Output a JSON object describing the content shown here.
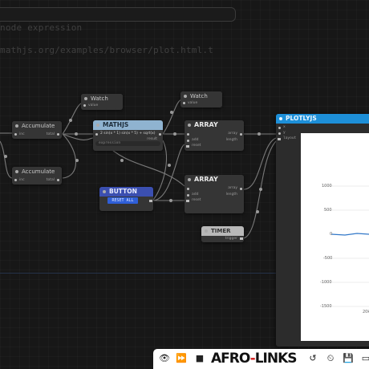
{
  "background_text": {
    "line1": "node expression",
    "line2": "mathjs.org/examples/browser/plot.html.t"
  },
  "nodes": {
    "watch1": {
      "title": "Watch",
      "port_in": "value"
    },
    "watch2": {
      "title": "Watch",
      "port_in": "value"
    },
    "accumulate1": {
      "title": "Accumulate",
      "port_in": "inc",
      "port_out": "total"
    },
    "accumulate2": {
      "title": "Accumulate",
      "port_in": "inc",
      "port_out": "total"
    },
    "mathjs": {
      "title": "MATHJS",
      "port_in": "x",
      "port_out": "result",
      "formula": "2 sin(x * 1) sin(x * 5) + sqrt(x)",
      "expression": "expression"
    },
    "array1": {
      "title": "ARRAY",
      "port_in1": "value",
      "port_in2": "add",
      "port_in3": "reset",
      "port_out1": "array",
      "port_out2": "length"
    },
    "array2": {
      "title": "ARRAY",
      "port_in1": "value",
      "port_in2": "add",
      "port_in3": "reset",
      "port_out1": "array",
      "port_out2": "length"
    },
    "button": {
      "title": "BUTTON",
      "reset_label": "RESET ALL"
    },
    "timer": {
      "title": "TIMER",
      "port_out": "trigger"
    },
    "plotlyjs": {
      "title": "PLOTLYJS",
      "port_in1": "x",
      "port_in2": "y",
      "port_in3": "layout"
    }
  },
  "plot": {
    "y_ticks": [
      "1000",
      "500",
      "0",
      "-500",
      "-1000",
      "-1500"
    ],
    "x_tick": "20k"
  },
  "toolbar": {
    "brand_left": "AFRO",
    "brand_dash": "-",
    "brand_right": "LINKS",
    "icons": [
      "eye-icon",
      "fast-forward-icon",
      "stop-icon",
      "history-icon",
      "timer-icon",
      "save-icon",
      "panel-icon"
    ]
  }
}
